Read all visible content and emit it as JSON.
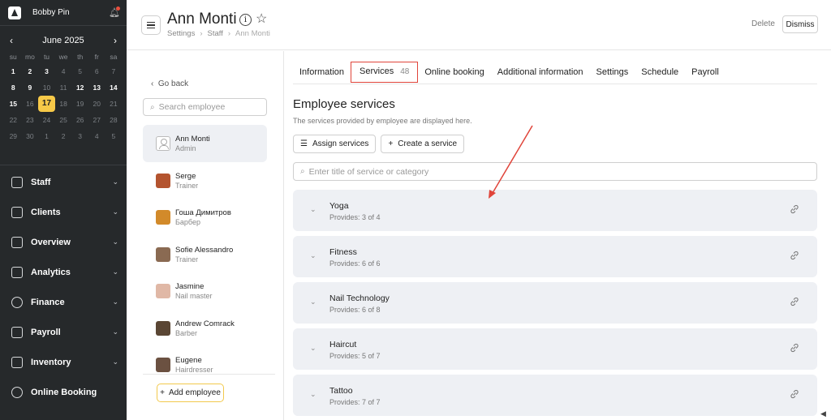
{
  "brand": {
    "name": "Bobby Pin"
  },
  "calendar": {
    "month": "June 2025",
    "prev": "‹",
    "next": "›",
    "dows": [
      "su",
      "mo",
      "tu",
      "we",
      "th",
      "fr",
      "sa"
    ],
    "days": [
      {
        "d": "1",
        "s": "bold"
      },
      {
        "d": "2",
        "s": "bold"
      },
      {
        "d": "3",
        "s": "bold"
      },
      {
        "d": "4",
        "s": "muted"
      },
      {
        "d": "5",
        "s": "muted"
      },
      {
        "d": "6",
        "s": "muted"
      },
      {
        "d": "7",
        "s": "muted"
      },
      {
        "d": "8",
        "s": "bold"
      },
      {
        "d": "9",
        "s": "bold"
      },
      {
        "d": "10",
        "s": "muted"
      },
      {
        "d": "11",
        "s": "muted"
      },
      {
        "d": "12",
        "s": "bold"
      },
      {
        "d": "13",
        "s": "bold"
      },
      {
        "d": "14",
        "s": "bold"
      },
      {
        "d": "15",
        "s": "bold"
      },
      {
        "d": "16",
        "s": "muted"
      },
      {
        "d": "17",
        "s": "today"
      },
      {
        "d": "18",
        "s": "muted"
      },
      {
        "d": "19",
        "s": "muted"
      },
      {
        "d": "20",
        "s": "muted"
      },
      {
        "d": "21",
        "s": "muted"
      },
      {
        "d": "22",
        "s": "muted"
      },
      {
        "d": "23",
        "s": "muted"
      },
      {
        "d": "24",
        "s": "muted"
      },
      {
        "d": "25",
        "s": "muted"
      },
      {
        "d": "26",
        "s": "muted"
      },
      {
        "d": "27",
        "s": "muted"
      },
      {
        "d": "28",
        "s": "muted"
      },
      {
        "d": "29",
        "s": "muted"
      },
      {
        "d": "30",
        "s": "muted"
      },
      {
        "d": "1",
        "s": "muted"
      },
      {
        "d": "2",
        "s": "muted"
      },
      {
        "d": "3",
        "s": "muted"
      },
      {
        "d": "4",
        "s": "muted"
      },
      {
        "d": "5",
        "s": "muted"
      }
    ]
  },
  "nav": [
    {
      "label": "Staff",
      "icon": "person-icon"
    },
    {
      "label": "Clients",
      "icon": "clients-icon"
    },
    {
      "label": "Overview",
      "icon": "overview-icon"
    },
    {
      "label": "Analytics",
      "icon": "analytics-icon"
    },
    {
      "label": "Finance",
      "icon": "dollar-icon"
    },
    {
      "label": "Payroll",
      "icon": "payroll-icon"
    },
    {
      "label": "Inventory",
      "icon": "inventory-icon"
    },
    {
      "label": "Online Booking",
      "icon": "globe-icon"
    }
  ],
  "header": {
    "title": "Ann Monti",
    "breadcrumb": [
      "Settings",
      "Staff",
      "Ann Monti"
    ],
    "delete_label": "Delete",
    "dismiss_label": "Dismiss"
  },
  "employees": {
    "back_label": "Go back",
    "search_placeholder": "Search employee",
    "list": [
      {
        "name": "Ann Monti",
        "role": "Admin",
        "active": true,
        "avatar": "placeholder"
      },
      {
        "name": "Serge",
        "role": "Trainer",
        "avatar": "#b4542f"
      },
      {
        "name": "Гоша Димитров",
        "role": "Барбер",
        "avatar": "#d28a2a"
      },
      {
        "name": "Sofie Alessandro",
        "role": "Trainer",
        "avatar": "#8a6a52"
      },
      {
        "name": "Jasmine",
        "role": "Nail master",
        "avatar": "#e0b8a6"
      },
      {
        "name": "Andrew Comrack",
        "role": "Barber",
        "avatar": "#5a4634"
      },
      {
        "name": "Eugene",
        "role": "Hairdresser",
        "avatar": "#6b5141"
      }
    ],
    "add_label": "Add employee"
  },
  "tabs": [
    {
      "label": "Information"
    },
    {
      "label": "Services",
      "count": "48",
      "active": true
    },
    {
      "label": "Online booking"
    },
    {
      "label": "Additional information"
    },
    {
      "label": "Settings"
    },
    {
      "label": "Schedule"
    },
    {
      "label": "Payroll"
    }
  ],
  "services_section": {
    "title": "Employee services",
    "description": "The services provided by employee are displayed here.",
    "assign_label": "Assign services",
    "create_label": "Create a service",
    "search_placeholder": "Enter title of service or category",
    "items": [
      {
        "name": "Yoga",
        "provides": "Provides: 3 of 4"
      },
      {
        "name": "Fitness",
        "provides": "Provides: 6 of 6"
      },
      {
        "name": "Nail Technology",
        "provides": "Provides: 6 of 8"
      },
      {
        "name": "Haircut",
        "provides": "Provides: 5 of 7"
      },
      {
        "name": "Tattoo",
        "provides": "Provides: 7 of 7"
      }
    ]
  },
  "colors": {
    "sidebar_bg": "#26292b",
    "accent_yellow": "#f7c948",
    "highlight_red": "#e0443a",
    "card_bg": "#eef0f4"
  }
}
